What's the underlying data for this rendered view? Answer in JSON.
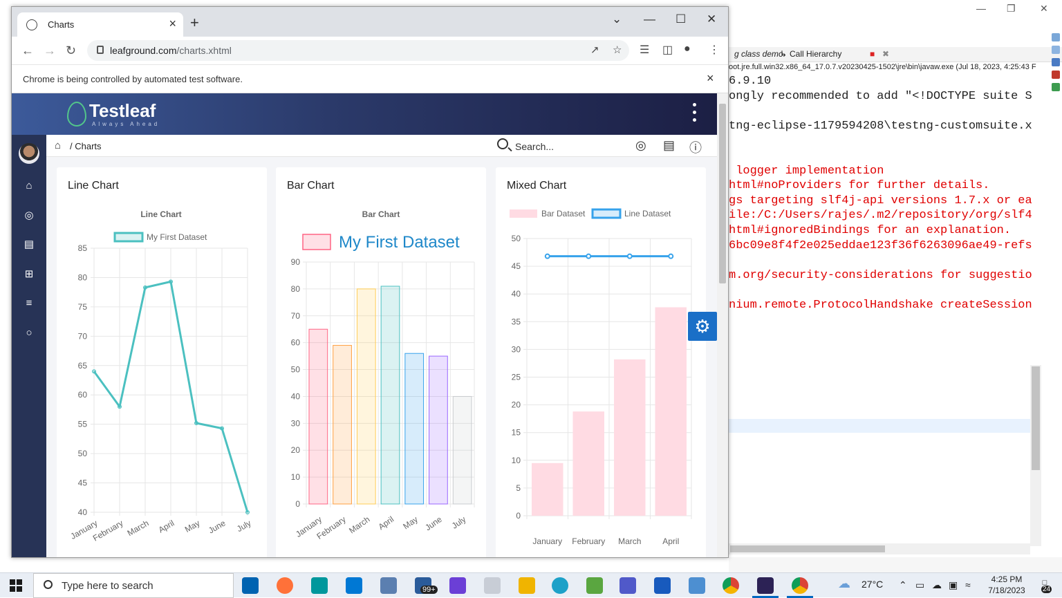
{
  "browser": {
    "tab_title": "Charts",
    "url_host": "leafground.com",
    "url_path": "/charts.xhtml",
    "infobar_text": "Chrome is being controlled by automated test software."
  },
  "site": {
    "logo": "Testleaf",
    "tagline": "Always Ahead",
    "breadcrumb": "/ Charts",
    "search_placeholder": "Search..."
  },
  "cards": {
    "line_title": "Line Chart",
    "bar_title": "Bar Chart",
    "mixed_title": "Mixed Chart"
  },
  "chart_data": [
    {
      "type": "line",
      "title": "Line Chart",
      "categories": [
        "January",
        "February",
        "March",
        "April",
        "May",
        "June",
        "July"
      ],
      "series": [
        {
          "name": "My First Dataset",
          "values": [
            64,
            58,
            78.3,
            79.3,
            55.2,
            54.3,
            40
          ],
          "color": "#4bc0c0"
        }
      ],
      "ylim": [
        40,
        85
      ],
      "yticks": [
        40,
        45,
        50,
        55,
        60,
        65,
        70,
        75,
        80,
        85
      ],
      "grid": true,
      "legend": "top"
    },
    {
      "type": "bar",
      "title": "Bar Chart",
      "categories": [
        "January",
        "February",
        "March",
        "April",
        "May",
        "June",
        "July"
      ],
      "series": [
        {
          "name": "My First Dataset",
          "values": [
            65,
            59,
            80,
            81,
            56,
            55,
            40
          ]
        }
      ],
      "colors": [
        "#ff6384",
        "#ff9f40",
        "#ffcd56",
        "#4bc0c0",
        "#36a2eb",
        "#9966ff",
        "#c9cbcf"
      ],
      "ylim": [
        0,
        90
      ],
      "yticks": [
        0,
        10,
        20,
        30,
        40,
        50,
        60,
        70,
        80,
        90
      ],
      "grid": true,
      "legend": "top"
    },
    {
      "type": "bar",
      "categories": [
        "January",
        "February",
        "March",
        "April"
      ],
      "series": [
        {
          "name": "Bar Dataset",
          "type": "bar",
          "values": [
            9.5,
            18.8,
            28.2,
            37.6
          ],
          "color": "#ffdbe3"
        },
        {
          "name": "Line Dataset",
          "type": "line",
          "values": [
            46.8,
            46.8,
            46.8,
            46.8
          ],
          "color": "#36a2eb"
        }
      ],
      "ylim": [
        0,
        50
      ],
      "yticks": [
        0,
        5,
        10,
        15,
        20,
        25,
        30,
        35,
        40,
        45,
        50
      ],
      "grid": true,
      "legend": "top"
    }
  ],
  "ide": {
    "toolbar_text": "g class demo",
    "call_hierarchy": "Call Hierarchy",
    "java_path": "oot.jre.full.win32.x86_64_17.0.7.v20230425-1502\\jre\\bin\\javaw.exe  (Jul 18, 2023, 4:25:43 F",
    "console_lines": [
      {
        "text": "6.9.10",
        "red": false
      },
      {
        "text": "ongly recommended to add \"<!DOCTYPE suite S",
        "red": false
      },
      {
        "text": "",
        "red": false
      },
      {
        "text": "tng-eclipse-1179594208\\testng-customsuite.x",
        "red": false
      },
      {
        "text": "",
        "red": false
      },
      {
        "text": "",
        "red": false
      },
      {
        "text": " logger implementation",
        "red": true
      },
      {
        "text": "html#noProviders for further details.",
        "red": true
      },
      {
        "text": "gs targeting slf4j-api versions 1.7.x or ea",
        "red": true
      },
      {
        "text": "ile:/C:/Users/rajes/.m2/repository/org/slf4",
        "red": true
      },
      {
        "text": "html#ignoredBindings for an explanation.",
        "red": true
      },
      {
        "text": "6bc09e8f4f2e025eddae123f36f6263096ae49-refs",
        "red": true
      },
      {
        "text": "",
        "red": false
      },
      {
        "text": "m.org/security-considerations for suggestio",
        "red": true
      },
      {
        "text": "",
        "red": false
      },
      {
        "text": "nium.remote.ProtocolHandshake createSession",
        "red": true
      }
    ]
  },
  "taskbar": {
    "search_placeholder": "Type here to search",
    "badge": "99+",
    "temperature": "27°C",
    "time": "4:25 PM",
    "date": "7/18/2023",
    "notifications": "24"
  }
}
